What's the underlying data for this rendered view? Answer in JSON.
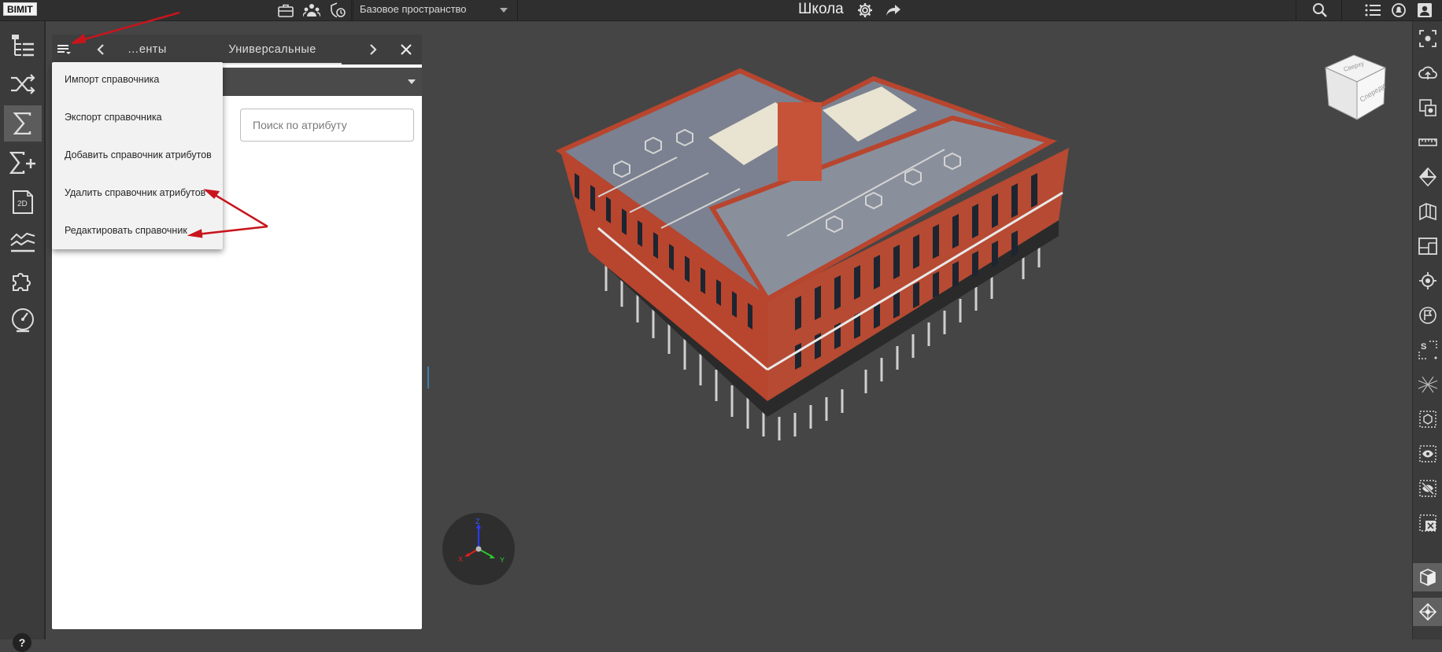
{
  "app": {
    "logo_text": "BIMIT",
    "project_title": "Школа"
  },
  "space_selector": {
    "value": "Базовое пространство"
  },
  "panel": {
    "tabs": [
      {
        "label": "…енты",
        "active": false
      },
      {
        "label": "Универсальные атрибуты",
        "active": true
      }
    ],
    "search_placeholder": "Поиск по атрибуту"
  },
  "dropdown_menu": {
    "items": [
      {
        "label": "Импорт справочника"
      },
      {
        "label": "Экспорт справочника"
      },
      {
        "label": "Добавить справочник атрибутов"
      },
      {
        "label": "Удалить справочник атрибутов"
      },
      {
        "label": "Редактировать справочник"
      }
    ]
  },
  "left_rail": {
    "items": [
      "model-tree-icon",
      "shuffle-icon",
      "sum-icon",
      "sum-plus-icon",
      "2d-drawing-icon",
      "chart-lines-icon",
      "puzzle-icon",
      "gauge-icon"
    ],
    "active": "sum-icon",
    "drawing_label": "2D"
  },
  "right_rail": {
    "items": [
      "focus-icon",
      "cloud-icon",
      "section-box-icon",
      "ruler-icon",
      "slice-plane-icon",
      "clipping-icon",
      "floor-plan-icon",
      "locate-icon",
      "flag-icon",
      "select-box-icon",
      "grid-icon",
      "isolate-box-icon",
      "show-icon",
      "hide-icon",
      "clear-selection-icon",
      "material-icon",
      "transparency-icon"
    ]
  },
  "navcube": {
    "face_front": "Спереди",
    "face_top": "Сверху"
  },
  "axes": {
    "x": "X",
    "y": "Y",
    "z": "Z"
  },
  "help": {
    "label": "?"
  },
  "colors": {
    "accent_red": "#c8151c",
    "facade": "#b8452e",
    "roof": "#7b8190",
    "background": "#454545"
  }
}
